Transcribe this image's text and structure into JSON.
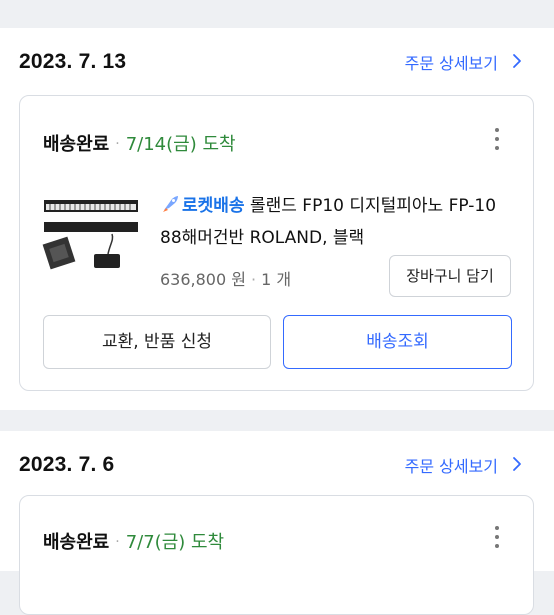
{
  "orders": [
    {
      "date": "2023. 7. 13",
      "detail_link": "주문 상세보기",
      "status": "배송완료",
      "eta": "7/14(금) 도착",
      "item": {
        "badge": "로켓배송",
        "title": "롤랜드 FP10 디지털피아노 FP-10 88해머건반 ROLAND, 블랙",
        "price": "636,800 원",
        "quantity": "1 개",
        "cart_button": "장바구니 담기"
      },
      "exchange_button": "교환, 반품 신청",
      "track_button": "배송조회"
    },
    {
      "date": "2023. 7. 6",
      "detail_link": "주문 상세보기",
      "status": "배송완료",
      "eta": "7/7(금) 도착"
    }
  ],
  "colors": {
    "accent": "#346aff",
    "status_green": "#2f8a3b",
    "badge_blue": "#1a73e8",
    "background": "#eef0f3"
  },
  "icons": {
    "chevron": "chevron-right-icon",
    "menu": "more-vertical-icon",
    "rocket": "rocket-icon"
  }
}
